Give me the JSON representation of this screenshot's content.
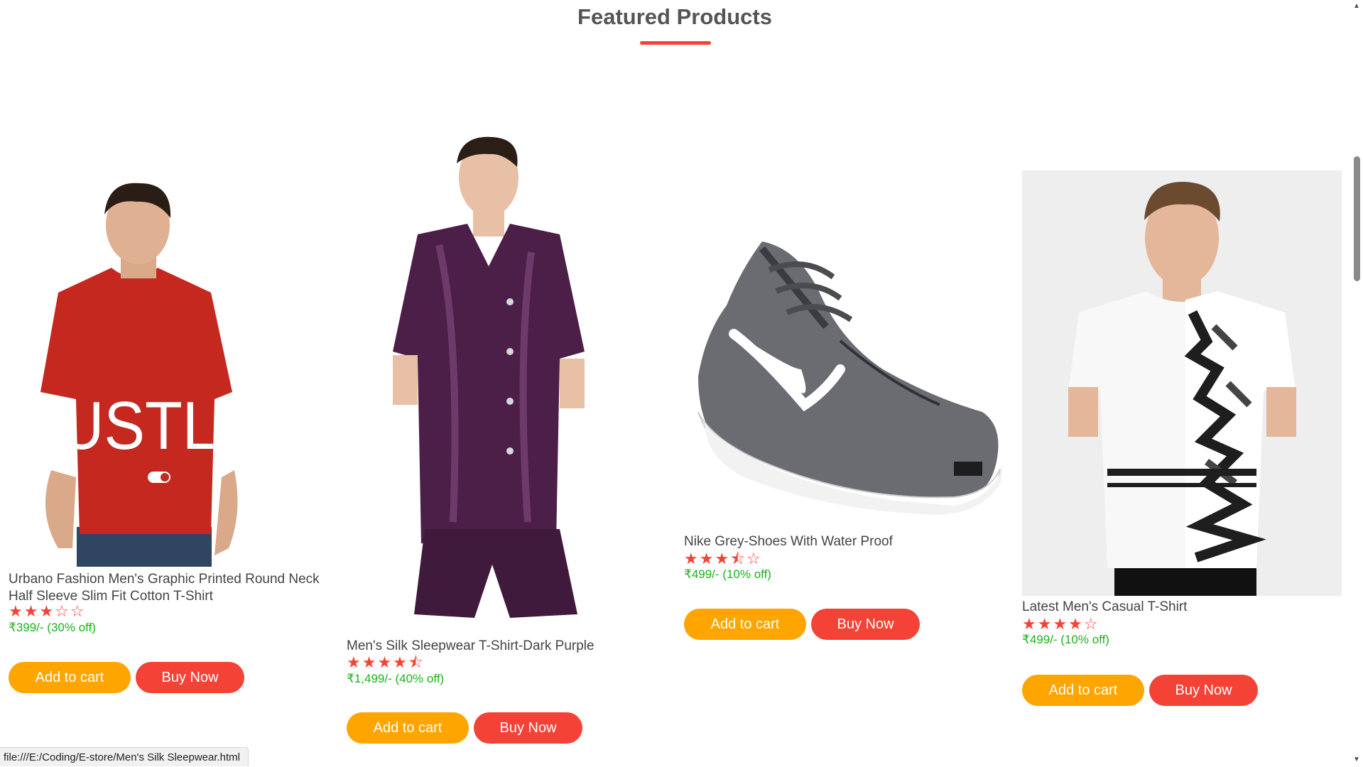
{
  "section": {
    "title": "Featured Products"
  },
  "products": [
    {
      "name": "Urbano Fashion Men's Graphic Printed Round Neck Half Sleeve Slim Fit Cotton T-Shirt",
      "stars": "★★★☆☆",
      "rating": 3,
      "price": "₹399/- (30% off)",
      "image_icon": "red-hustle-tshirt-image",
      "add_to_cart": "Add to cart",
      "buy_now": "Buy Now"
    },
    {
      "name": "Men's Silk Sleepwear T-Shirt-Dark Purple",
      "stars": "★★★★⯪",
      "rating": 4.5,
      "price": "₹1,499/- (40% off)",
      "image_icon": "purple-silk-sleepwear-image",
      "add_to_cart": "Add to cart",
      "buy_now": "Buy Now"
    },
    {
      "name": "Nike Grey-Shoes With Water Proof",
      "stars": "★★★⯪☆",
      "rating": 3.5,
      "price": "₹499/- (10% off)",
      "image_icon": "grey-nike-shoe-image",
      "add_to_cart": "Add to cart",
      "buy_now": "Buy Now"
    },
    {
      "name": "Latest Men's Casual T-Shirt",
      "stars": "★★★★☆",
      "rating": 4,
      "price": "₹499/- (10% off)",
      "image_icon": "printed-casual-tshirt-image",
      "add_to_cart": "Add to cart",
      "buy_now": "Buy Now"
    }
  ],
  "status_bar": {
    "url": "file:///E:/Coding/E-store/Men's Silk Sleepwear.html"
  },
  "colors": {
    "accent_red": "#f44336",
    "cart_orange": "#ffa500",
    "price_green": "#1bb21b",
    "title_gray": "#555555"
  }
}
